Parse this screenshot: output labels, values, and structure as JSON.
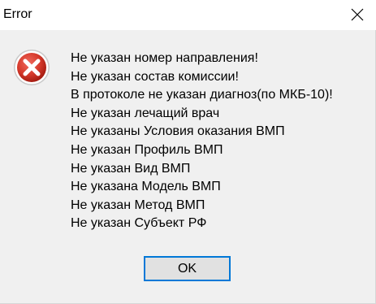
{
  "window": {
    "title": "Error"
  },
  "icon": {
    "name": "error-icon",
    "color": "#c42b1c"
  },
  "messages": [
    "Не указан номер направления!",
    "Не указан состав комиссии!",
    "В протоколе не указан диагноз(по МКБ-10)!",
    "Не указан лечащий врач",
    "Не указаны Условия оказания ВМП",
    "Не указан Профиль ВМП",
    "Не указан Вид ВМП",
    "Не указана Модель ВМП",
    "Не указан Метод ВМП",
    "Не указан Субъект РФ"
  ],
  "buttons": {
    "ok_label": "OK"
  },
  "colors": {
    "dialog_background": "#f0f0f0",
    "button_border": "#0078d7",
    "button_background": "#e1e1e1"
  }
}
